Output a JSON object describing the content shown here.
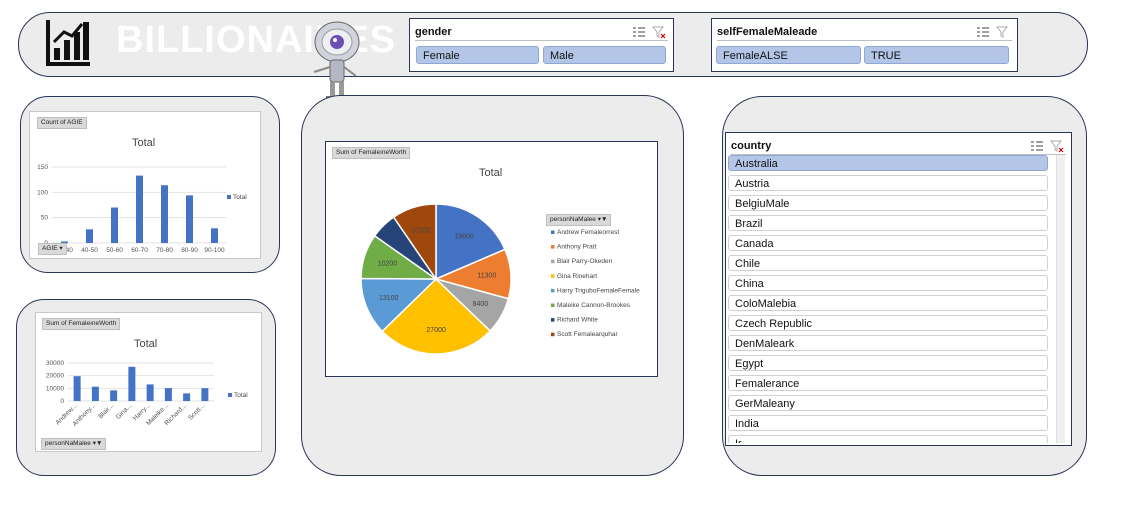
{
  "header": {
    "title": "BILLIONAIRES",
    "title_color": "#ffffff"
  },
  "gender_slicer": {
    "title": "gender",
    "items": [
      "Female",
      "Male"
    ]
  },
  "self_slicer": {
    "title": "selfFemaleMaleade",
    "items": [
      "FemaleALSE",
      "TRUE"
    ]
  },
  "age_chart": {
    "field_button": "Count of AGIE",
    "axis_button": "AGIE",
    "chart_data": {
      "type": "bar",
      "title": "Total",
      "categories": [
        "30-40",
        "40-50",
        "50-60",
        "60-70",
        "70-80",
        "80-90",
        "90-100"
      ],
      "series": [
        {
          "name": "Total",
          "values": [
            3,
            27,
            70,
            133,
            114,
            94,
            29
          ]
        }
      ],
      "ylim": [
        0,
        150
      ],
      "yticks": [
        "0",
        "50",
        "100",
        "150"
      ],
      "legend": "right",
      "color": "#4472c4"
    }
  },
  "worth_chart": {
    "field_button": "Sum of FemaleıneWorth",
    "axis_button": "personNaMalee",
    "chart_data": {
      "type": "bar",
      "title": "Total",
      "categories": [
        "Andrew...",
        "Anthony...",
        "Blair...",
        "Gina...",
        "Harry...",
        "Maleike...",
        "Richard...",
        "Scott..."
      ],
      "series": [
        {
          "name": "Total",
          "values": [
            19600,
            11300,
            8400,
            27000,
            13100,
            10200,
            6000,
            10100
          ]
        }
      ],
      "ylim": [
        0,
        30000
      ],
      "yticks": [
        "0",
        "10000",
        "20000",
        "30000"
      ],
      "legend": "right",
      "color": "#4472c4"
    }
  },
  "pie_chart": {
    "field_button": "Sum of FemaleıneWorth",
    "legend_button": "personNaMalee",
    "chart_data": {
      "type": "pie",
      "title": "Total",
      "legend": "right",
      "slices": [
        {
          "label": "Andrew Femaleorrest",
          "value": 19600,
          "shown": "19600",
          "color": "#4472c4"
        },
        {
          "label": "Anthony Pratt",
          "value": 11300,
          "shown": "11300",
          "color": "#ed7d31"
        },
        {
          "label": "Blair Parry-Okeden",
          "value": 8400,
          "shown": "8400",
          "color": "#a5a5a5"
        },
        {
          "label": "Gina Rinehart",
          "value": 27000,
          "shown": "27000",
          "color": "#ffc000"
        },
        {
          "label": "Harry TriguboFemaleFemale",
          "value": 13100,
          "shown": "13100",
          "color": "#5b9bd5"
        },
        {
          "label": "Maleike Cannon-Brookes",
          "value": 10200,
          "shown": "10200",
          "color": "#70ad47"
        },
        {
          "label": "Richard White",
          "value": 6000,
          "shown": "",
          "color": "#264478"
        },
        {
          "label": "Scott Femalearquhar",
          "value": 10100,
          "shown": "10100",
          "color": "#9e480e"
        }
      ]
    }
  },
  "country_slicer": {
    "title": "country",
    "items": [
      "Australia",
      "Austria",
      "BelgiuMale",
      "Brazil",
      "Canada",
      "Chile",
      "China",
      "ColoMalebia",
      "Czech Republic",
      "DenMaleark",
      "Egypt",
      "Femalerance",
      "GerMaleany",
      "India",
      "Ir..."
    ],
    "selected": "Australia"
  }
}
